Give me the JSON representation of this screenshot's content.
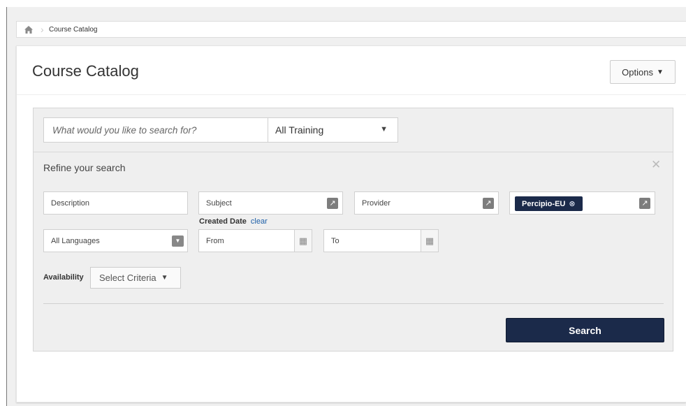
{
  "breadcrumb": {
    "home_icon": "home-icon",
    "items": [
      "Course Catalog"
    ]
  },
  "header": {
    "title": "Course Catalog",
    "options_label": "Options"
  },
  "search": {
    "placeholder": "What would you like to search for?",
    "training_type": "All Training"
  },
  "refine": {
    "title": "Refine your search",
    "description_placeholder": "Description",
    "subject_placeholder": "Subject",
    "provider_placeholder": "Provider",
    "selected_provider_tag": "Percipio-EU",
    "language": "All Languages",
    "created_date_label": "Created Date",
    "created_date_clear": "clear",
    "from_placeholder": "From",
    "to_placeholder": "To",
    "availability_label": "Availability",
    "availability_select": "Select Criteria",
    "search_button": "Search"
  },
  "colors": {
    "primary_dark": "#1b2a4a",
    "link": "#1d5fa8",
    "panel_bg": "#efefef"
  }
}
